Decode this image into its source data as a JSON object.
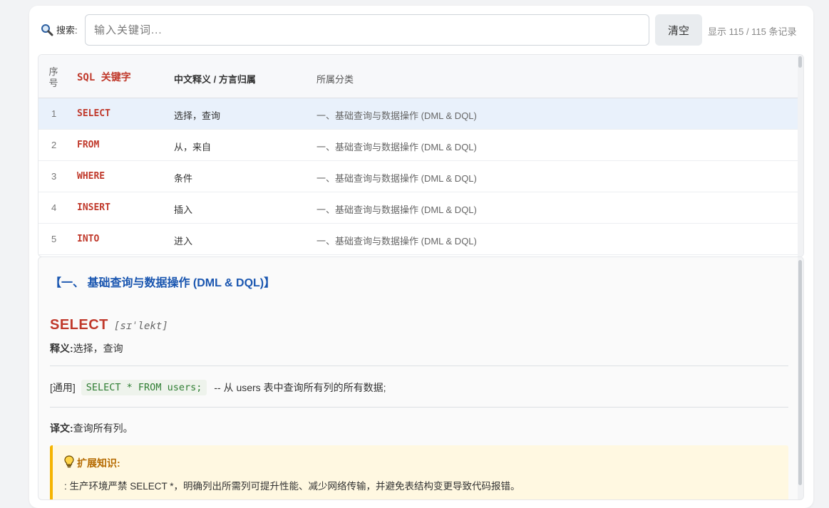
{
  "search": {
    "label": "搜索:",
    "placeholder": "输入关键词...",
    "value": "",
    "clear_label": "清空",
    "count_text": "显示 115 / 115 条记录"
  },
  "table": {
    "headers": {
      "num": "序号",
      "keyword": "SQL 关键字",
      "meaning": "中文释义 / 方言归属",
      "category": "所属分类"
    },
    "rows": [
      {
        "num": "1",
        "keyword": "SELECT",
        "meaning": "选择，查询",
        "category": "一、基础查询与数据操作 (DML & DQL)"
      },
      {
        "num": "2",
        "keyword": "FROM",
        "meaning": "从，来自",
        "category": "一、基础查询与数据操作 (DML & DQL)"
      },
      {
        "num": "3",
        "keyword": "WHERE",
        "meaning": "条件",
        "category": "一、基础查询与数据操作 (DML & DQL)"
      },
      {
        "num": "4",
        "keyword": "INSERT",
        "meaning": "插入",
        "category": "一、基础查询与数据操作 (DML & DQL)"
      },
      {
        "num": "5",
        "keyword": "INTO",
        "meaning": "进入",
        "category": "一、基础查询与数据操作 (DML & DQL)"
      }
    ],
    "selected_row": 1
  },
  "detail": {
    "section_title": "【一、 基础查询与数据操作 (DML & DQL)】",
    "keyword": "SELECT",
    "phonetic": "[sɪˈlekt]",
    "meaning_label": "释义:",
    "meaning": "选择，查询",
    "example_tag": "[通用]",
    "example_code": "SELECT * FROM users;",
    "example_desc": "-- 从 users 表中查询所有列的所有数据;",
    "translation_label": "译文:",
    "translation": "查询所有列。",
    "tip_title": "扩展知识:",
    "tip_text": ": 生产环境严禁 SELECT *，明确列出所需列可提升性能、减少网络传输，并避免表结构变更导致代码报错。"
  },
  "colors": {
    "keyword": "#c0392b",
    "section_title": "#1a56b0",
    "code": "#2e7d32",
    "tip_border": "#f5b400",
    "selected_row": "#e9f1fb"
  },
  "icons": {
    "search": "magnifier-icon",
    "tip": "lightbulb-icon"
  }
}
